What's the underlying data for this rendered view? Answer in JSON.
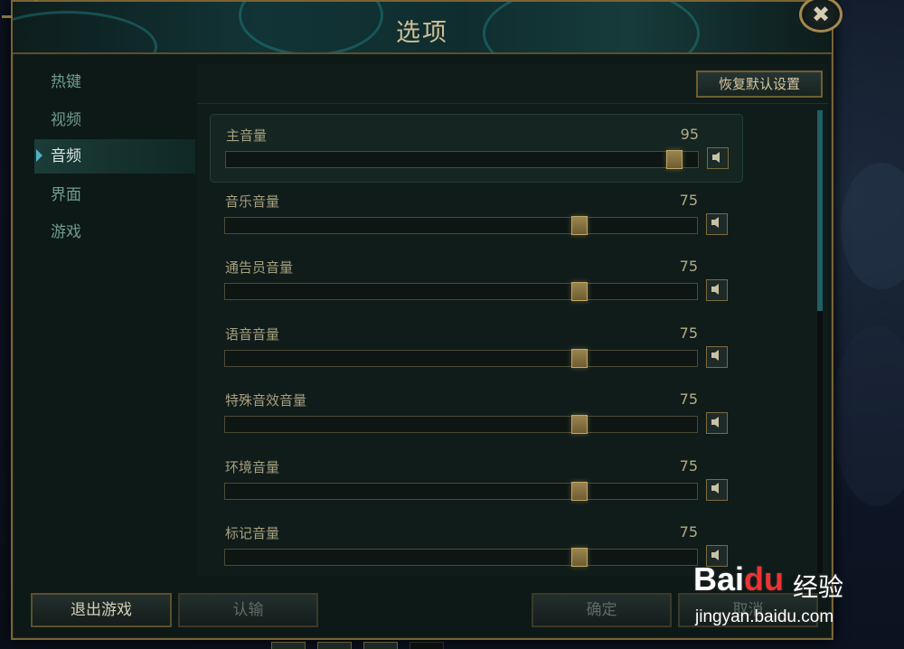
{
  "window": {
    "title": "选项",
    "close_glyph": "✖"
  },
  "sidebar": {
    "items": [
      {
        "label": "热键",
        "active": false
      },
      {
        "label": "视频",
        "active": false
      },
      {
        "label": "音频",
        "active": true
      },
      {
        "label": "界面",
        "active": false
      },
      {
        "label": "游戏",
        "active": false
      }
    ]
  },
  "toolbar": {
    "reset_label": "恢复默认设置"
  },
  "sliders": [
    {
      "label": "主音量",
      "value": "95",
      "percent": 0.95
    },
    {
      "label": "音乐音量",
      "value": "75",
      "percent": 0.75
    },
    {
      "label": "通告员音量",
      "value": "75",
      "percent": 0.75
    },
    {
      "label": "语音音量",
      "value": "75",
      "percent": 0.75
    },
    {
      "label": "特殊音效音量",
      "value": "75",
      "percent": 0.75
    },
    {
      "label": "环境音量",
      "value": "75",
      "percent": 0.75
    },
    {
      "label": "标记音量",
      "value": "75",
      "percent": 0.75
    }
  ],
  "footer": {
    "exit_label": "退出游戏",
    "surrender_label": "认输",
    "confirm_label": "确定",
    "cancel_label": "取消"
  },
  "watermark": {
    "logo_prefix": "Bai",
    "logo_suffix": "du",
    "jingyan": "经验",
    "url": "jingyan.baidu.com"
  },
  "colors": {
    "accent_gold": "#a3874c",
    "accent_teal": "#4fb2c2"
  }
}
